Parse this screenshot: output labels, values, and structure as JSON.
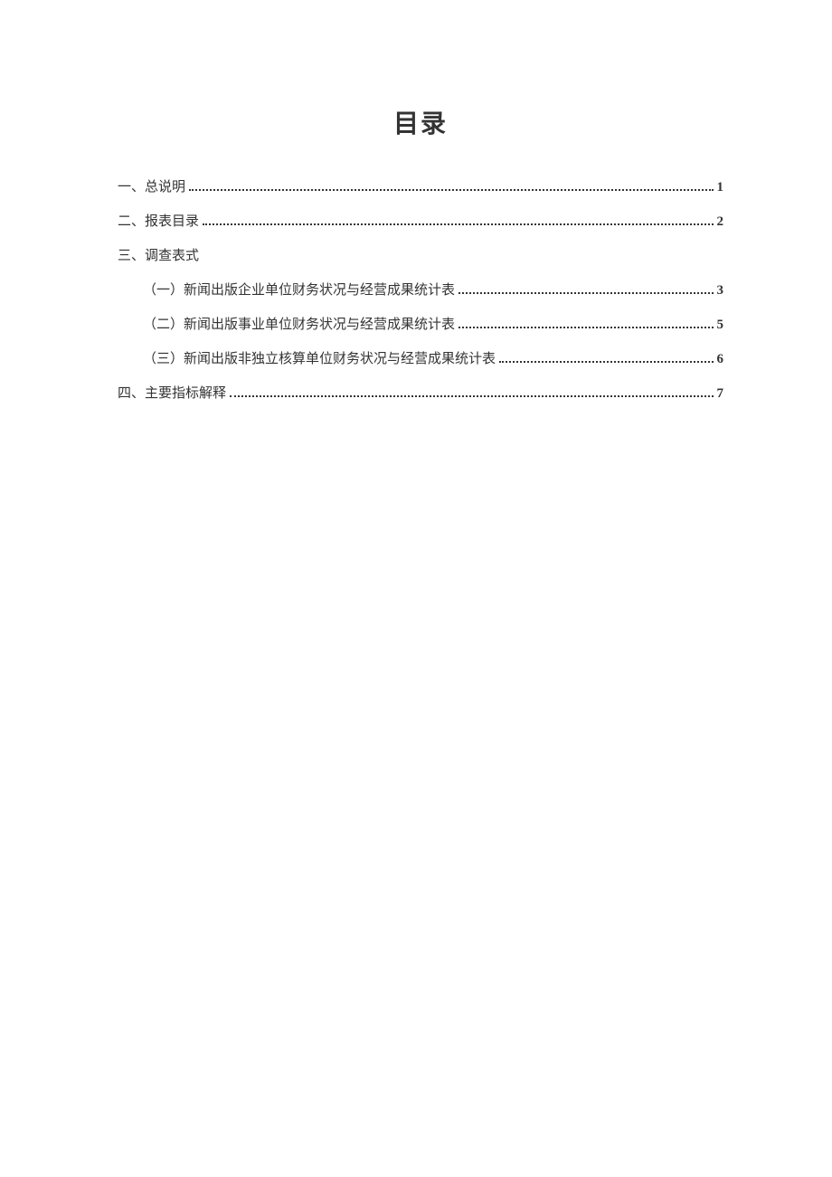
{
  "title": "目录",
  "entries": [
    {
      "label": "一、总说明",
      "page": "1",
      "indent": false,
      "hasPage": true
    },
    {
      "label": "二、报表目录",
      "page": "2",
      "indent": false,
      "hasPage": true
    },
    {
      "label": "三、调查表式",
      "page": "",
      "indent": false,
      "hasPage": false
    },
    {
      "label": "（一）新闻出版企业单位财务状况与经营成果统计表",
      "page": "3",
      "indent": true,
      "hasPage": true
    },
    {
      "label": "（二）新闻出版事业单位财务状况与经营成果统计表",
      "page": "5",
      "indent": true,
      "hasPage": true
    },
    {
      "label": "（三）新闻出版非独立核算单位财务状况与经营成果统计表",
      "page": "6",
      "indent": true,
      "hasPage": true
    },
    {
      "label": "四、主要指标解释",
      "page": "7",
      "indent": false,
      "hasPage": true
    }
  ]
}
